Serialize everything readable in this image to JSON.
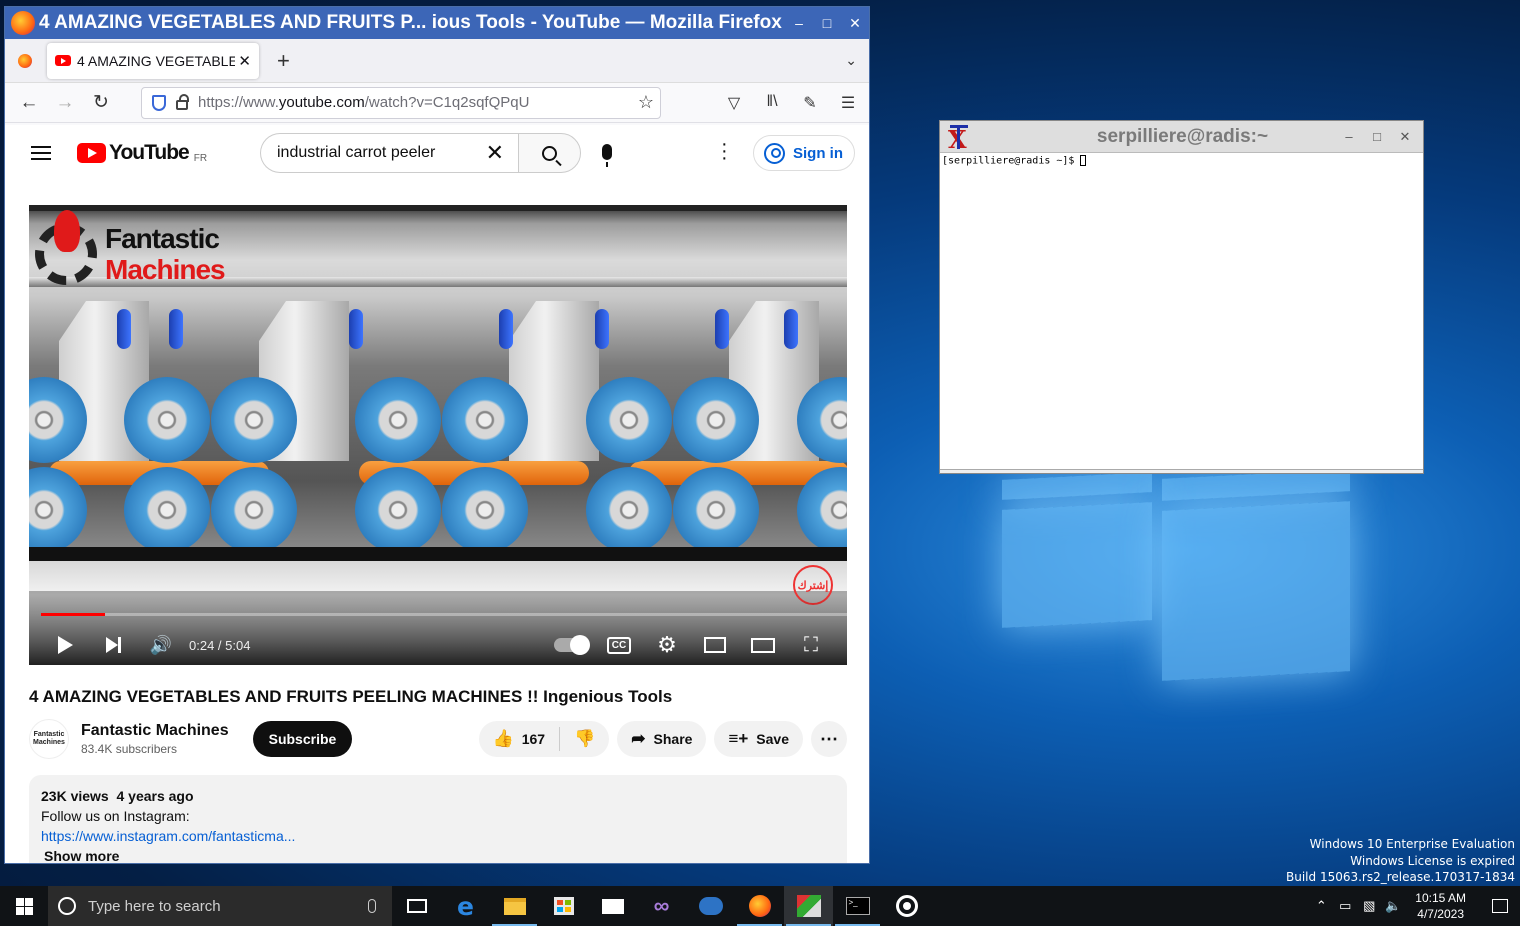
{
  "firefox": {
    "window_title": "4 AMAZING VEGETABLES AND FRUITS P... ious Tools - YouTube — Mozilla Firefox",
    "tab_label": "4 AMAZING VEGETABLES",
    "url_prefix": "https://www.",
    "url_host": "youtube.com",
    "url_path": "/watch?v=C1q2sqfQPqU"
  },
  "youtube": {
    "logo_text": "YouTube",
    "country_code": "FR",
    "search_query": "industrial carrot peeler",
    "sign_in_label": "Sign in",
    "video": {
      "brand_line1": "Fantastic",
      "brand_line2": "Machines",
      "badge_text": "إشترك",
      "time": "0:24 / 5:04",
      "progress_fraction": 0.079
    },
    "title": "4 AMAZING VEGETABLES AND FRUITS PEELING MACHINES !! Ingenious Tools",
    "channel_name": "Fantastic Machines",
    "subscribers": "83.4K subscribers",
    "avatar_text": "Fantastic Machines",
    "subscribe_label": "Subscribe",
    "like_count": "167",
    "share_label": "Share",
    "save_label": "Save",
    "description": {
      "meta": "23K views  4 years ago",
      "line1": "Follow us on Instagram:",
      "link": "https://www.instagram.com/fantasticma...",
      "show_more": "Show more"
    }
  },
  "xterm": {
    "title": "serpilliere@radis:~",
    "prompt": "[serpilliere@radis ~]$ "
  },
  "desktop": {
    "eval_line1": "Windows 10 Enterprise Evaluation",
    "eval_line2": "Windows License is expired",
    "eval_line3": "Build 15063.rs2_release.170317-1834"
  },
  "taskbar": {
    "search_placeholder": "Type here to search",
    "time": "10:15 AM",
    "date": "4/7/2023"
  },
  "colors": {
    "firefox_titlebar": "#3c66b7",
    "youtube_red": "#ff0000",
    "link_blue": "#065fd4",
    "taskbar": "#101316"
  }
}
